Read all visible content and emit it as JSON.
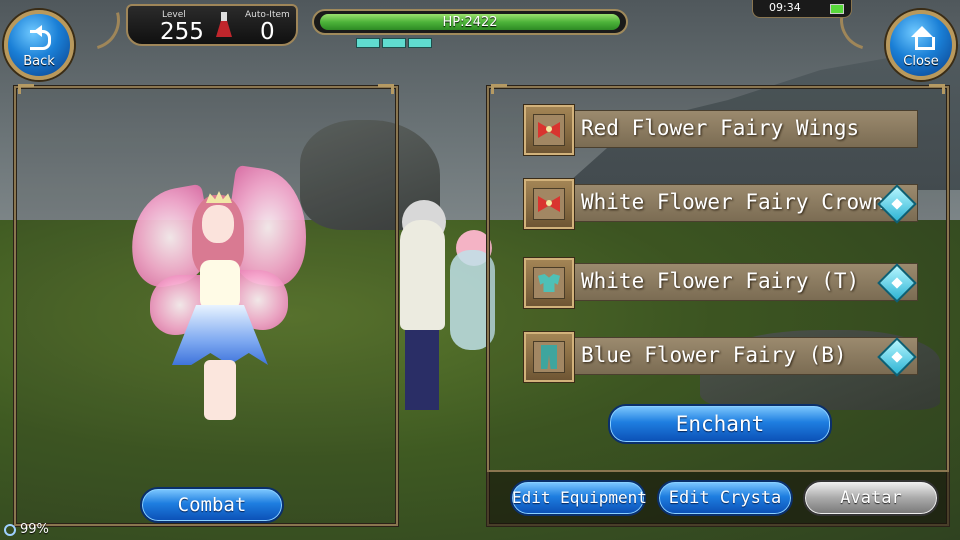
{
  "hud": {
    "level_label": "Level",
    "level_value": "255",
    "auto_item_label": "Auto-Item",
    "auto_item_value": "0",
    "hp_text": "HP:2422",
    "hp_fraction": 1.0,
    "mp_pips": 3,
    "time": "09:34"
  },
  "nav": {
    "back_label": "Back",
    "close_label": "Close"
  },
  "equipment": [
    {
      "name": "Red Flower Fairy Wings",
      "icon": "red-bow-icon",
      "enchantable": false
    },
    {
      "name": "White Flower Fairy Crown",
      "icon": "red-bow-icon",
      "enchantable": true
    },
    {
      "name": "White Flower Fairy (T)",
      "icon": "top-armor-icon",
      "enchantable": true
    },
    {
      "name": "Blue Flower Fairy (B)",
      "icon": "bottom-armor-icon",
      "enchantable": true
    }
  ],
  "buttons": {
    "enchant": "Enchant",
    "combat": "Combat",
    "edit_equipment": "Edit Equipment",
    "edit_crysta": "Edit Crysta",
    "avatar": "Avatar"
  },
  "status": {
    "fps": "99%"
  },
  "colors": {
    "hp_green": "#4db43a",
    "button_blue": "#1e7ee0",
    "frame_gold": "#9f8659",
    "enchant_diamond": "#2db4d4"
  }
}
